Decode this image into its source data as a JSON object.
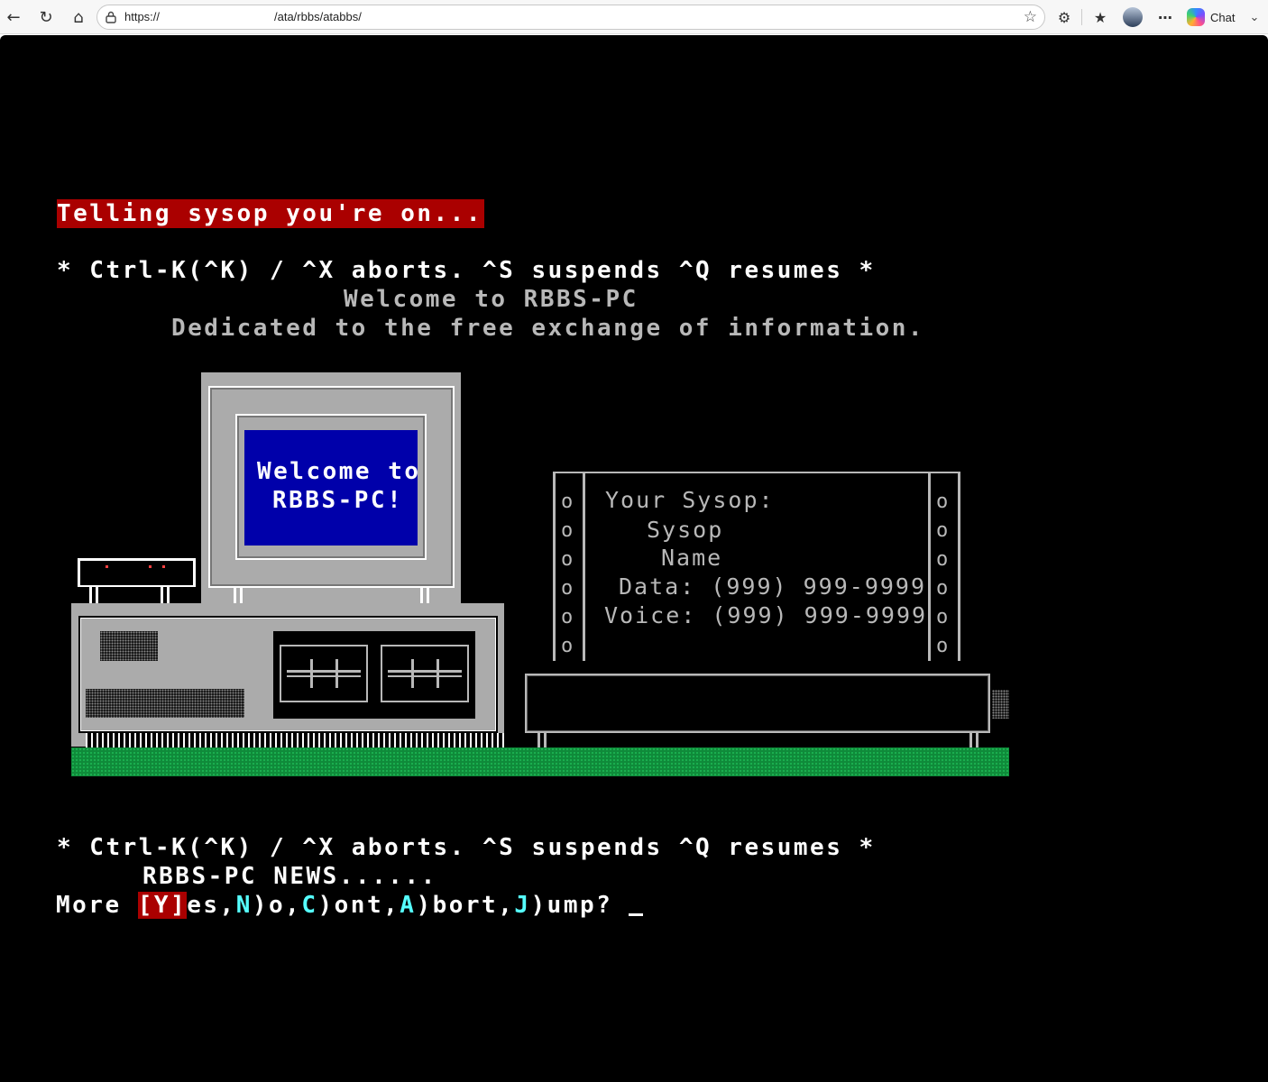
{
  "browser": {
    "url_prefix": "https://",
    "url_path": "/ata/rbbs/atabbs/",
    "chat_label": "Chat"
  },
  "terminal": {
    "status_banner": "Telling sysop you're on...",
    "controls_line_1": "* Ctrl-K(^K) / ^X aborts. ^S suspends ^Q resumes *",
    "welcome_line": "Welcome to RBBS-PC",
    "dedicated_line": "Dedicated to the free exchange of information.",
    "screen_line_1": "Welcome to",
    "screen_line_2": "RBBS-PC!",
    "sysop_sign": {
      "line_1": "Your Sysop:",
      "line_2": "Sysop",
      "line_3": "Name",
      "line_4": "Data: (999) 999-9999",
      "line_5": "Voice: (999) 999-9999",
      "side_marks": "o\no\no\no\no\no"
    },
    "controls_line_2": "* Ctrl-K(^K) / ^X aborts. ^S suspends ^Q resumes *",
    "news_line": "RBBS-PC NEWS......",
    "prompt": {
      "more": "More ",
      "yes_key": "[Y]",
      "yes_rest": "es,",
      "no_key": "N",
      "no_rest": ")o,",
      "cont_key": "C",
      "cont_rest": ")ont,",
      "abort_key": "A",
      "abort_rest": ")bort,",
      "jump_key": "J",
      "jump_rest": ")ump? "
    }
  },
  "colors": {
    "background": "#000000",
    "highlight_red": "#aa0000",
    "screen_blue": "#0000aa",
    "key_cyan": "#55ffff",
    "grass_green": "#0f8a3a"
  }
}
